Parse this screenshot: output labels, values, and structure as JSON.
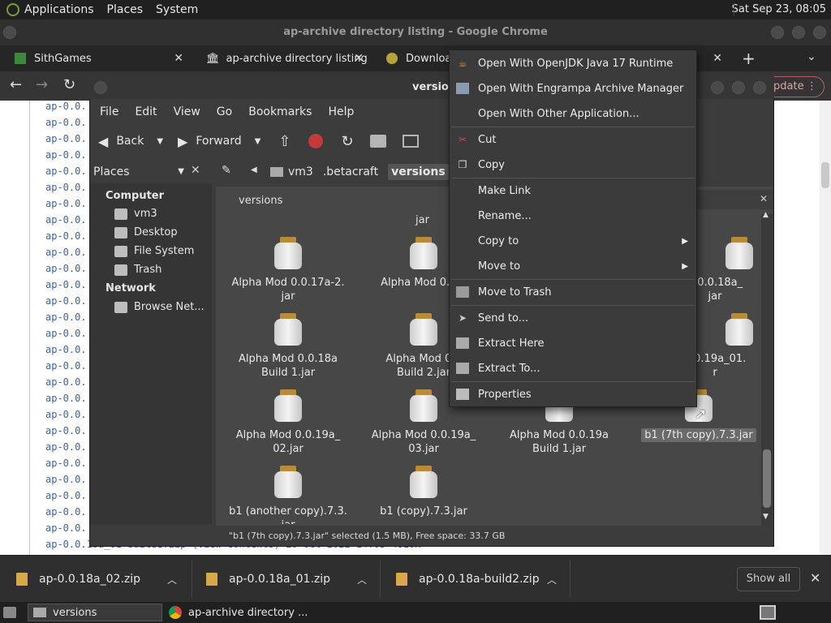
{
  "top_panel": {
    "menus": [
      "Applications",
      "Places",
      "System"
    ],
    "clock": "Sat Sep 23, 08:05"
  },
  "chrome": {
    "title": "ap-archive directory listing - Google Chrome",
    "tabs": [
      {
        "label": "SithGames"
      },
      {
        "label": "ap-archive directory listing"
      },
      {
        "label": "Downloads"
      }
    ],
    "update_label": "pdate"
  },
  "webpage": {
    "line_prefix": "ap-0.0.",
    "bottom_line": "ap-0.0.18a_01-build1.zip (view contents)          20-Oct-2022 14:03     4810K"
  },
  "file_manager": {
    "title": "version",
    "menus": [
      "File",
      "Edit",
      "View",
      "Go",
      "Bookmarks",
      "Help"
    ],
    "toolbar": {
      "back": "Back",
      "forward": "Forward"
    },
    "sidebar_selector": "Places",
    "breadcrumbs": [
      "vm3",
      ".betacraft",
      "versions"
    ],
    "sidebar": {
      "computer_header": "Computer",
      "computer_items": [
        "vm3",
        "Desktop",
        "File System",
        "Trash"
      ],
      "network_header": "Network",
      "network_items": [
        "Browse Net..."
      ]
    },
    "pane_title": "versions",
    "partial_label": "jar",
    "files": [
      {
        "name": "Alpha Mod 0.0.17a-2.\njar"
      },
      {
        "name": "Alpha Mod 0.0.1"
      },
      {
        "name": "d 0.0.18a_\njar"
      },
      {
        "name": "Alpha Mod 0.0.18a\nBuild 1.jar"
      },
      {
        "name": "Alpha Mod 0.0\nBuild 2.jar"
      },
      {
        "name": "0.0.19a_01.\nr"
      },
      {
        "name": "Alpha Mod 0.0.19a_\n02.jar"
      },
      {
        "name": "Alpha Mod 0.0.19a_\n03.jar"
      },
      {
        "name": "Alpha Mod 0.0.19a\nBuild 1.jar"
      },
      {
        "name": "b1 (7th copy).7.3.jar"
      },
      {
        "name": "b1 (another copy).7.3.\njar"
      },
      {
        "name": "b1 (copy).7.3.jar"
      }
    ],
    "status": "\"b1 (7th copy).7.3.jar\" selected (1.5 MB), Free space: 33.7 GB"
  },
  "context_menu": {
    "items": [
      {
        "label": "Open With OpenJDK Java 17 Runtime",
        "icon": "java-icon"
      },
      {
        "label": "Open With Engrampa Archive Manager",
        "icon": "archive-icon"
      },
      {
        "label": "Open With Other Application...",
        "icon": ""
      },
      {
        "label": "Cut",
        "icon": "scissors-icon"
      },
      {
        "label": "Copy",
        "icon": "copy-icon"
      },
      {
        "label": "Make Link",
        "icon": ""
      },
      {
        "label": "Rename...",
        "icon": ""
      },
      {
        "label": "Copy to",
        "icon": "",
        "submenu": true
      },
      {
        "label": "Move to",
        "icon": "",
        "submenu": true
      },
      {
        "label": "Move to Trash",
        "icon": "trash-icon"
      },
      {
        "label": "Send to...",
        "icon": "send-icon"
      },
      {
        "label": "Extract Here",
        "icon": "extract-icon"
      },
      {
        "label": "Extract To...",
        "icon": "extract-icon"
      },
      {
        "label": "Properties",
        "icon": "properties-icon"
      }
    ]
  },
  "downloads": {
    "items": [
      "ap-0.0.18a_02.zip",
      "ap-0.0.18a_01.zip",
      "ap-0.0.18a-build2.zip"
    ],
    "show_all": "Show all"
  },
  "taskbar": {
    "items": [
      "versions",
      "ap-archive directory ..."
    ]
  }
}
